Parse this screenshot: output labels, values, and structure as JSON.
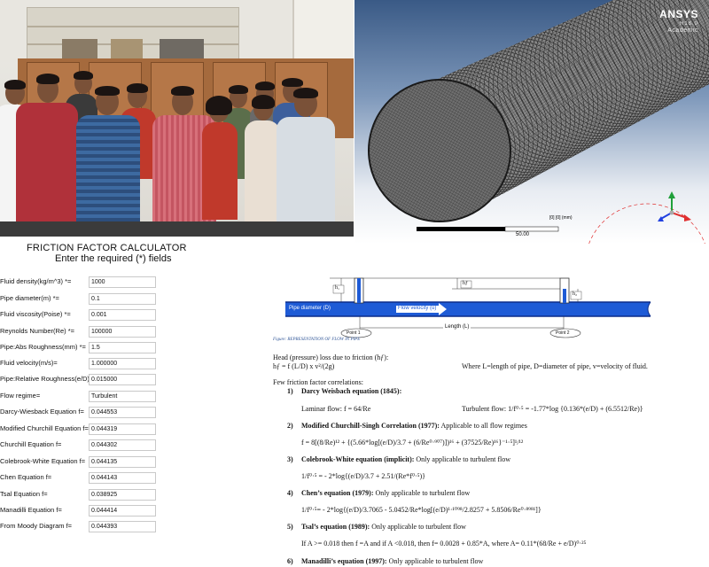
{
  "ansys": {
    "logo": "ANSYS",
    "version": "R18.0",
    "edition": "Academic",
    "scale_value": "50.00",
    "scale_unit": "[0] [0] (mm)"
  },
  "calculator": {
    "title": "FRICTION FACTOR CALCULATOR",
    "subtitle": "Enter the required (*) fields",
    "fields": [
      {
        "label": "Fluid density(kg/m^3) *=",
        "value": "1000"
      },
      {
        "label": "Pipe diameter(m) *=",
        "value": "0.1"
      },
      {
        "label": "Fluid viscosity(Poise) *=",
        "value": "0.001"
      },
      {
        "label": "Reynolds Number(Re) *=",
        "value": "100000"
      },
      {
        "label": "Pipe:Abs Roughness(mm) *=",
        "value": "1.5"
      },
      {
        "label": "Fluid velocity(m/s)=",
        "value": "1.000000"
      },
      {
        "label": "Pipe:Relative Roughness(e/D)=",
        "value": "0.015000"
      },
      {
        "label": "Flow regime=",
        "value": "Turbulent"
      },
      {
        "label": "Darcy-Wiesback Equation f=",
        "value": "0.044553"
      },
      {
        "label": "Modified Churchill Equation f=",
        "value": "0.044319"
      },
      {
        "label": "Churchill Equation f=",
        "value": "0.044302"
      },
      {
        "label": "Colebrook-White Equation f=",
        "value": "0.044135"
      },
      {
        "label": "Chen Equation f=",
        "value": "0.044143"
      },
      {
        "label": "Tsal Equation f=",
        "value": "0.038925"
      },
      {
        "label": "Manadilli Equation f=",
        "value": "0.044414"
      },
      {
        "label": "From Moody Diagram f=",
        "value": "0.044393"
      }
    ]
  },
  "document": {
    "diagram": {
      "pipe_label": "Pipe diameter (D)",
      "velocity_label": "Flow velocity (u)",
      "length_label": "Length (L)",
      "point1": "Point 1",
      "point2": "Point 2",
      "h1": "h₁",
      "hf": "hƒ",
      "h2": "h₂",
      "caption": "Figure: REPRESENTATION OF FLOW IN PIPE"
    },
    "head_loss_title": "Head (pressure) loss due to friction (hƒ):",
    "head_loss_formula": "hƒ = f (L/D) x v²/(2g)",
    "head_loss_where": "Where L=length of pipe, D=diameter of pipe, v=velocity of fluid.",
    "correlations_title": "Few friction factor correlations:",
    "eq1_num": "1)",
    "eq1_title": "Darcy Weisbach equation (1845):",
    "eq1_laminar": "Laminar flow: f = 64/Re",
    "eq1_turbulent": "Turbulent flow: 1/f⁰·⁵ = -1.77*log {0.136*(e/D) + (6.5512/Re)}",
    "eq2_num": "2)",
    "eq2_title": "Modified Churchill-Singh Correlation (1977):",
    "eq2_note": "Applicable to all flow regimes",
    "eq2_formula": "f = 8[(8/Re)¹² + {(5.66*log[(e/D)/3.7 + (6/Re⁰·⁹⁰⁷)])¹⁶ + (37525/Re)¹⁶}⁻¹·⁵]¹/¹²",
    "eq3_num": "3)",
    "eq3_title": "Colebrook-White equation (implicit):",
    "eq3_note": "Only applicable to turbulent flow",
    "eq3_formula": "1/f⁰·⁵ = - 2*log{(e/D)/3.7 + 2.51/(Re*f⁰·⁵)}",
    "eq4_num": "4)",
    "eq4_title": "Chen’s equation (1979):",
    "eq4_note": "Only applicable to turbulent flow",
    "eq4_formula": "1/f⁰·⁵= - 2*log{(e/D)/3.7065 - 5.0452/Re*log[(e/D)¹·¹⁰⁹⁸/2.8257 + 5.8506/Re⁰·⁸⁹⁸¹]}",
    "eq5_num": "5)",
    "eq5_title": "Tsal’s equation (1989):",
    "eq5_note": "Only applicable to turbulent flow",
    "eq5_formula": "If A >= 0.018 then f =A and if A <0.018, then f= 0.0028 + 0.85*A, where A= 0.11*(68/Re + e/D)⁰·²⁵",
    "eq6_num": "6)",
    "eq6_title": "Manadilli’s equation (1997):",
    "eq6_note": "Only applicable to turbulent flow"
  },
  "colors": {
    "pipe_blue": "#1e5bd6",
    "pipe_dark": "#0b2c8a",
    "mesh_line": "#2b2b2b",
    "caption_blue": "#2f5597"
  }
}
